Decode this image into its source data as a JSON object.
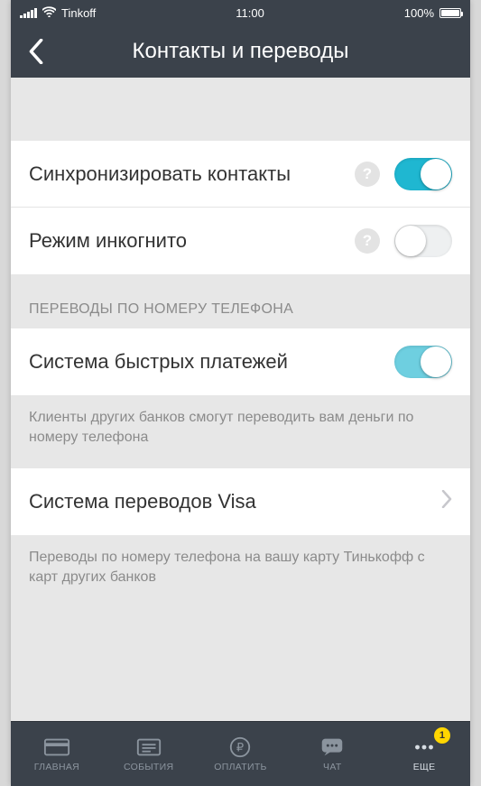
{
  "statusbar": {
    "carrier": "Tinkoff",
    "time": "11:00",
    "battery": "100%"
  },
  "header": {
    "title": "Контакты и переводы"
  },
  "rows": {
    "sync": {
      "label": "Синхронизировать контакты",
      "help": "?",
      "on": true
    },
    "incognito": {
      "label": "Режим инкогнито",
      "help": "?",
      "on": false
    },
    "sbp": {
      "label": "Система быстрых платежей",
      "on": true
    },
    "visa": {
      "label": "Система переводов Visa"
    }
  },
  "sections": {
    "transfers_header": "ПЕРЕВОДЫ ПО НОМЕРУ ТЕЛЕФОНА",
    "sbp_footer": "Клиенты других банков смогут переводить вам деньги по номеру телефона",
    "visa_footer": "Переводы по номеру телефона на вашу карту Тинькофф с карт других банков"
  },
  "tabs": {
    "home": "ГЛАВНАЯ",
    "events": "СОБЫТИЯ",
    "pay": "ОПЛАТИТЬ",
    "chat": "ЧАТ",
    "more": "ЕЩЕ",
    "badge": "1"
  }
}
